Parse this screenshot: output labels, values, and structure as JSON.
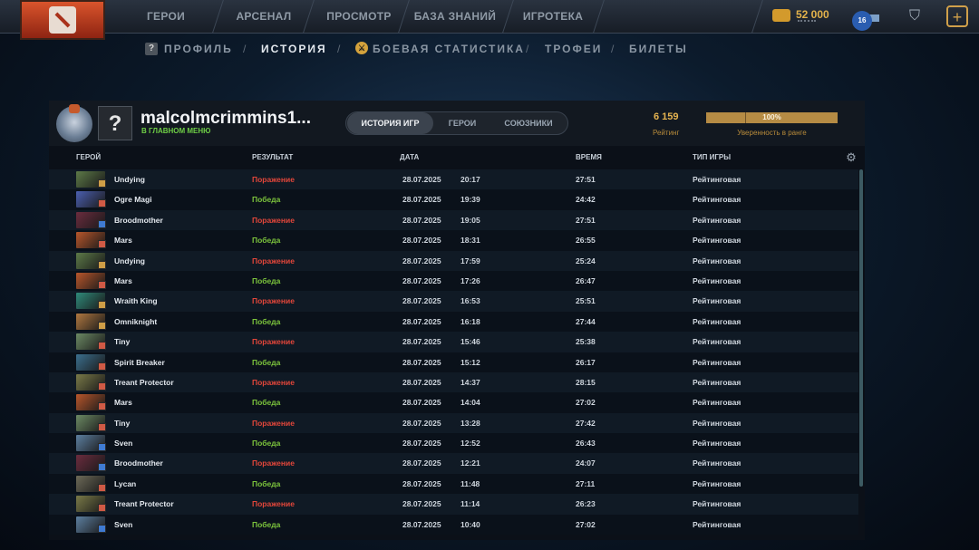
{
  "topnav": {
    "items": [
      "ГЕРОИ",
      "АРСЕНАЛ",
      "ПРОСМОТР",
      "БАЗА ЗНАНИЙ",
      "ИГРОТЕКА"
    ],
    "currency": "52 000",
    "level": "16"
  },
  "subnav": {
    "items": [
      "ПРОФИЛЬ",
      "ИСТОРИЯ",
      "БОЕВАЯ СТАТИСТИКА",
      "ТРОФЕИ",
      "БИЛЕТЫ"
    ],
    "active": "ИСТОРИЯ"
  },
  "profile": {
    "name": "malcolmcrimmins1...",
    "status": "В ГЛАВНОМ МЕНЮ",
    "tabs": [
      "ИСТОРИЯ ИГР",
      "ГЕРОИ",
      "СОЮЗНИКИ"
    ],
    "active_tab": "ИСТОРИЯ ИГР",
    "rating_value": "6 159",
    "rating_label": "Рейтинг",
    "confidence_value": "100%",
    "confidence_label": "Уверенность в ранге"
  },
  "table": {
    "headers": {
      "hero": "ГЕРОЙ",
      "result": "РЕЗУЛЬТАТ",
      "date": "ДАТА",
      "duration": "ВРЕМЯ",
      "type": "ТИП ИГРЫ"
    },
    "colors": {
      "win": "#7cc43c",
      "loss": "#e2463a"
    },
    "rows": [
      {
        "hero": "Undying",
        "result": "Поражение",
        "win": false,
        "date": "28.07.2025",
        "time": "20:17",
        "duration": "27:51",
        "type": "Рейтинговая",
        "hero_color": "#5d7a48",
        "badge_color": "#cf9e47"
      },
      {
        "hero": "Ogre Magi",
        "result": "Победа",
        "win": true,
        "date": "28.07.2025",
        "time": "19:39",
        "duration": "24:42",
        "type": "Рейтинговая",
        "hero_color": "#4b5fb0",
        "badge_color": "#d05a45"
      },
      {
        "hero": "Broodmother",
        "result": "Поражение",
        "win": false,
        "date": "28.07.2025",
        "time": "19:05",
        "duration": "27:51",
        "type": "Рейтинговая",
        "hero_color": "#6b2c3e",
        "badge_color": "#3f7bd2"
      },
      {
        "hero": "Mars",
        "result": "Победа",
        "win": true,
        "date": "28.07.2025",
        "time": "18:31",
        "duration": "26:55",
        "type": "Рейтинговая",
        "hero_color": "#b8562b",
        "badge_color": "#d05a45"
      },
      {
        "hero": "Undying",
        "result": "Поражение",
        "win": false,
        "date": "28.07.2025",
        "time": "17:59",
        "duration": "25:24",
        "type": "Рейтинговая",
        "hero_color": "#5d7a48",
        "badge_color": "#cf9e47"
      },
      {
        "hero": "Mars",
        "result": "Победа",
        "win": true,
        "date": "28.07.2025",
        "time": "17:26",
        "duration": "26:47",
        "type": "Рейтинговая",
        "hero_color": "#b8562b",
        "badge_color": "#d05a45"
      },
      {
        "hero": "Wraith King",
        "result": "Поражение",
        "win": false,
        "date": "28.07.2025",
        "time": "16:53",
        "duration": "25:51",
        "type": "Рейтинговая",
        "hero_color": "#2f8a7a",
        "badge_color": "#cf9e47"
      },
      {
        "hero": "Omniknight",
        "result": "Победа",
        "win": true,
        "date": "28.07.2025",
        "time": "16:18",
        "duration": "27:44",
        "type": "Рейтинговая",
        "hero_color": "#b07840",
        "badge_color": "#cf9e47"
      },
      {
        "hero": "Tiny",
        "result": "Поражение",
        "win": false,
        "date": "28.07.2025",
        "time": "15:46",
        "duration": "25:38",
        "type": "Рейтинговая",
        "hero_color": "#6c8a64",
        "badge_color": "#d05a45"
      },
      {
        "hero": "Spirit Breaker",
        "result": "Победа",
        "win": true,
        "date": "28.07.2025",
        "time": "15:12",
        "duration": "26:17",
        "type": "Рейтинговая",
        "hero_color": "#3b6f8e",
        "badge_color": "#d05a45"
      },
      {
        "hero": "Treant Protector",
        "result": "Поражение",
        "win": false,
        "date": "28.07.2025",
        "time": "14:37",
        "duration": "28:15",
        "type": "Рейтинговая",
        "hero_color": "#7a7a48",
        "badge_color": "#d05a45"
      },
      {
        "hero": "Mars",
        "result": "Победа",
        "win": true,
        "date": "28.07.2025",
        "time": "14:04",
        "duration": "27:02",
        "type": "Рейтинговая",
        "hero_color": "#b8562b",
        "badge_color": "#d05a45"
      },
      {
        "hero": "Tiny",
        "result": "Поражение",
        "win": false,
        "date": "28.07.2025",
        "time": "13:28",
        "duration": "27:42",
        "type": "Рейтинговая",
        "hero_color": "#6c8a64",
        "badge_color": "#d05a45"
      },
      {
        "hero": "Sven",
        "result": "Победа",
        "win": true,
        "date": "28.07.2025",
        "time": "12:52",
        "duration": "26:43",
        "type": "Рейтинговая",
        "hero_color": "#5c7fa0",
        "badge_color": "#3f7bd2"
      },
      {
        "hero": "Broodmother",
        "result": "Поражение",
        "win": false,
        "date": "28.07.2025",
        "time": "12:21",
        "duration": "24:07",
        "type": "Рейтинговая",
        "hero_color": "#6b2c3e",
        "badge_color": "#3f7bd2"
      },
      {
        "hero": "Lycan",
        "result": "Победа",
        "win": true,
        "date": "28.07.2025",
        "time": "11:48",
        "duration": "27:11",
        "type": "Рейтинговая",
        "hero_color": "#6d6a58",
        "badge_color": "#d05a45"
      },
      {
        "hero": "Treant Protector",
        "result": "Поражение",
        "win": false,
        "date": "28.07.2025",
        "time": "11:14",
        "duration": "26:23",
        "type": "Рейтинговая",
        "hero_color": "#7a7a48",
        "badge_color": "#d05a45"
      },
      {
        "hero": "Sven",
        "result": "Победа",
        "win": true,
        "date": "28.07.2025",
        "time": "10:40",
        "duration": "27:02",
        "type": "Рейтинговая",
        "hero_color": "#5c7fa0",
        "badge_color": "#3f7bd2"
      }
    ]
  }
}
